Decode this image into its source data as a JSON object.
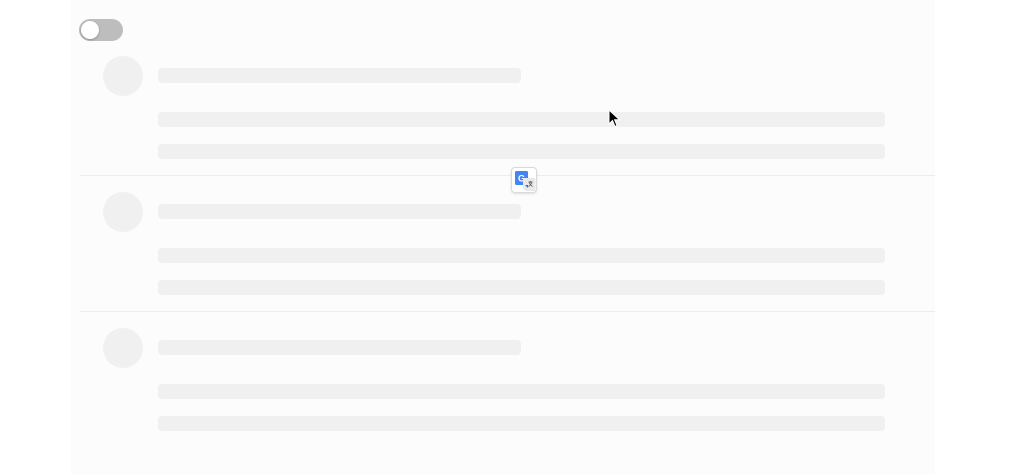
{
  "toggle": {
    "state": "off"
  },
  "skeleton_rows": [
    {
      "kind": "placeholder"
    },
    {
      "kind": "placeholder"
    },
    {
      "kind": "placeholder"
    }
  ],
  "icons": {
    "translate": "google-translate-icon",
    "cursor": "mouse-pointer-icon"
  },
  "colors": {
    "placeholder": "#f0f0f0",
    "panel_background": "#fcfcfc",
    "toggle_off": "#bdbdbd",
    "translate_blue": "#4285f4"
  }
}
